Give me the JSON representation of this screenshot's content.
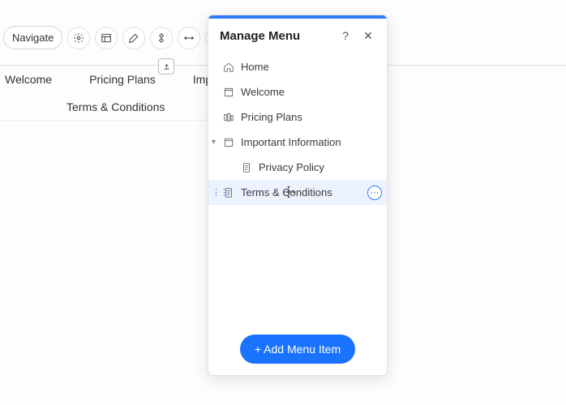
{
  "toolbar": {
    "navigate_label": "Navigate",
    "icons": [
      "gear",
      "layout",
      "brush",
      "diamond",
      "arrows-h",
      "help"
    ]
  },
  "top_tabs": [
    "Welcome",
    "Pricing Plans",
    "Important Information"
  ],
  "page_title": "Terms & Conditions",
  "panel": {
    "title": "Manage Menu",
    "items": [
      {
        "label": "Home",
        "icon": "home",
        "depth": 0,
        "selected": false
      },
      {
        "label": "Welcome",
        "icon": "page",
        "depth": 0,
        "selected": false
      },
      {
        "label": "Pricing Plans",
        "icon": "plans",
        "depth": 0,
        "selected": false
      },
      {
        "label": "Important Information",
        "icon": "page",
        "depth": 0,
        "selected": false,
        "expandable": true
      },
      {
        "label": "Privacy Policy",
        "icon": "doc",
        "depth": 1,
        "selected": false
      },
      {
        "label": "Terms & Conditions",
        "icon": "doc",
        "depth": 0,
        "selected": true
      }
    ],
    "add_label": "+ Add Menu Item"
  }
}
